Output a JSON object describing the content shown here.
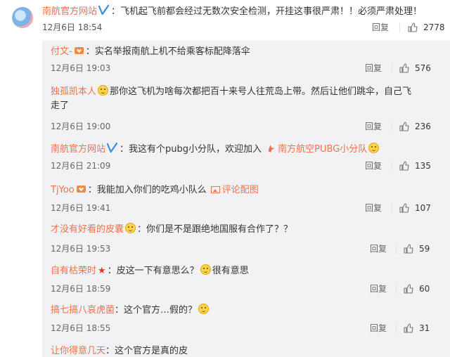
{
  "post": {
    "author": "南航官方网站",
    "text": "：飞机起飞前都会经过无数次安全检测，开挂这事很严肃！！必须严肃处理！",
    "time": "12月6日 18:54",
    "reply_label": "回复",
    "likes": "2778"
  },
  "comments": [
    {
      "user": "付文-",
      "badge": "fan-badge",
      "text": "：实名举报南航上机不给乘客标配降落伞",
      "time": "12月6日 19:03",
      "reply": "回复",
      "likes": "576"
    },
    {
      "user": "独孤凯本人",
      "badge": "emoji",
      "text": "那你这飞机为啥每次都把百十来号人往荒岛上带。然后让他们跳伞，自己飞",
      "text2": "走了",
      "time": "12月6日 19:00",
      "reply": "回复",
      "likes": "236"
    },
    {
      "user": "南航官方网站",
      "badge": "verified",
      "text": "：我这有个pubg小分队，欢迎加入",
      "link_text": "南方航空PUBG小分队",
      "time": "12月6日 21:09",
      "reply": "回复",
      "likes": "135"
    },
    {
      "user": "TjYoo",
      "badge": "fan-badge",
      "text": "：我能加入你们的吃鸡小队么",
      "link_text": "评论配图",
      "time": "12月6日 19:41",
      "reply": "回复",
      "likes": "107"
    },
    {
      "user": "才没有好看的皮囊",
      "badge": "emoji",
      "text": "：你们是不是跟绝地国服有合作了？？",
      "time": "12月6日 19:53",
      "reply": "回复",
      "likes": "59"
    },
    {
      "user": "自有枯荣时",
      "badge": "star",
      "text": "：皮这一下有意思么？",
      "text2": "很有意思",
      "time": "12月6日 18:59",
      "reply": "回复",
      "likes": "60"
    },
    {
      "user": "搞七搞八哀虎菌",
      "badge": "none",
      "text": "：这个官方…假的？",
      "time": "12月6日 18:55",
      "reply": "回复",
      "likes": "31"
    },
    {
      "user": "让你得意几天",
      "badge": "none",
      "text": "：这个官方是真的皮"
    }
  ],
  "colors": {
    "username": "#eb7350",
    "comment_bg": "#f2f2f5"
  }
}
